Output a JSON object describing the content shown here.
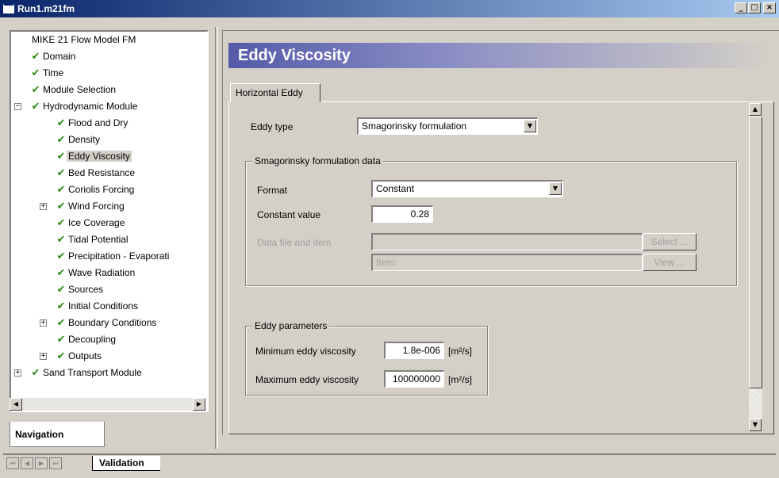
{
  "window": {
    "title": "Run1.m21fm",
    "min_label": "_",
    "max_label": "□",
    "close_label": "×"
  },
  "tree": {
    "items": [
      {
        "label": "MIKE 21 Flow Model FM"
      },
      {
        "label": "Domain"
      },
      {
        "label": "Time"
      },
      {
        "label": "Module Selection"
      },
      {
        "label": "Hydrodynamic Module"
      },
      {
        "label": "Flood and Dry"
      },
      {
        "label": "Density"
      },
      {
        "label": "Eddy Viscosity"
      },
      {
        "label": "Bed Resistance"
      },
      {
        "label": "Coriolis Forcing"
      },
      {
        "label": "Wind Forcing"
      },
      {
        "label": "Ice Coverage"
      },
      {
        "label": "Tidal Potential"
      },
      {
        "label": "Precipitation - Evaporati"
      },
      {
        "label": "Wave Radiation"
      },
      {
        "label": "Sources"
      },
      {
        "label": "Initial Conditions"
      },
      {
        "label": "Boundary Conditions"
      },
      {
        "label": "Decoupling"
      },
      {
        "label": "Outputs"
      },
      {
        "label": "Sand Transport Module"
      }
    ],
    "selected": "Eddy Viscosity",
    "check_glyph": "✔",
    "expand_glyph": "+",
    "collapse_glyph": "−"
  },
  "nav_tab": {
    "label": "Navigation"
  },
  "page": {
    "title": "Eddy Viscosity",
    "tab_label": "Horizontal Eddy"
  },
  "form": {
    "eddy_type_label": "Eddy type",
    "eddy_type_value": "Smagorinsky formulation",
    "smag_group_title": "Smagorinsky formulation data",
    "format_label": "Format",
    "format_value": "Constant",
    "constant_label": "Constant value",
    "constant_value": "0.28",
    "datafile_label": "Data file and item",
    "datafile_value": "",
    "item_placeholder": "Item:",
    "select_button": "Select ...",
    "view_button": "View ...",
    "eddy_params_title": "Eddy parameters",
    "min_label": "Minimum eddy viscosity",
    "min_value": "1.8e-006",
    "max_label": "Maximum eddy viscosity",
    "max_value": "100000000",
    "unit": "[m²/s]"
  },
  "bottom": {
    "validation_tab": "Validation"
  }
}
